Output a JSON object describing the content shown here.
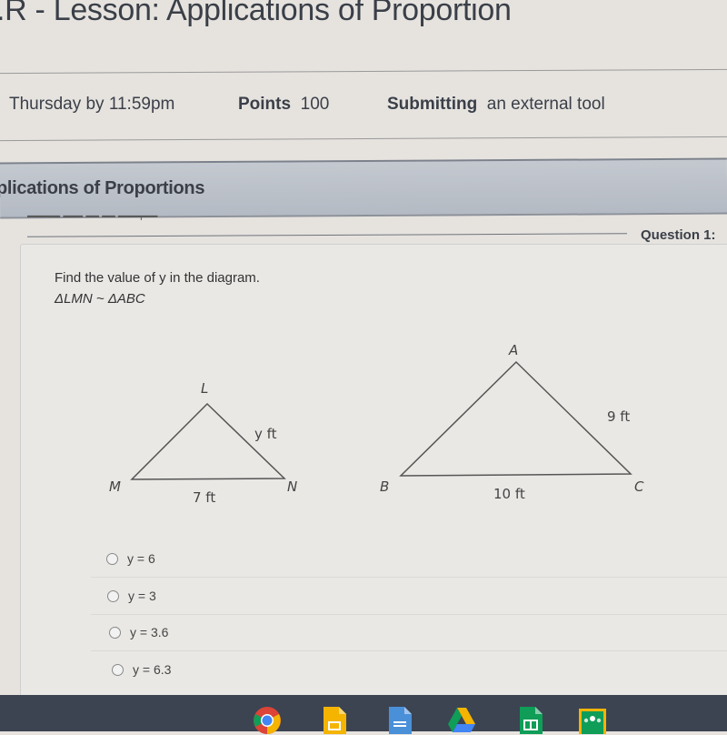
{
  "header": {
    "title": ".R - Lesson: Applications of Proportion",
    "due_label": "Thursday by 11:59pm",
    "points_label": "Points",
    "points_value": "100",
    "submitting_label": "Submitting",
    "submitting_value": "an external tool"
  },
  "tool_banner": {
    "title": "plications of Proportions"
  },
  "question": {
    "number_label": "Question 1:",
    "prompt": "Find the value of y in the diagram.",
    "similarity": "ΔLMN ~ ΔABC",
    "triangle_lmn": {
      "vertices": {
        "top": "L",
        "left": "M",
        "right": "N"
      },
      "side_ln": "y ft",
      "side_mn": "7 ft"
    },
    "triangle_abc": {
      "vertices": {
        "top": "A",
        "left": "B",
        "right": "C"
      },
      "side_ac": "9 ft",
      "side_bc": "10 ft"
    },
    "options": [
      {
        "label": "y = 6",
        "selected": false
      },
      {
        "label": "y = 3",
        "selected": false
      },
      {
        "label": "y = 3.6",
        "selected": false
      },
      {
        "label": "y = 6.3",
        "selected": false
      }
    ]
  },
  "taskbar": {
    "apps": [
      "chrome-icon",
      "slides-icon",
      "docs-icon",
      "drive-icon",
      "sheets-icon",
      "classroom-icon"
    ]
  }
}
